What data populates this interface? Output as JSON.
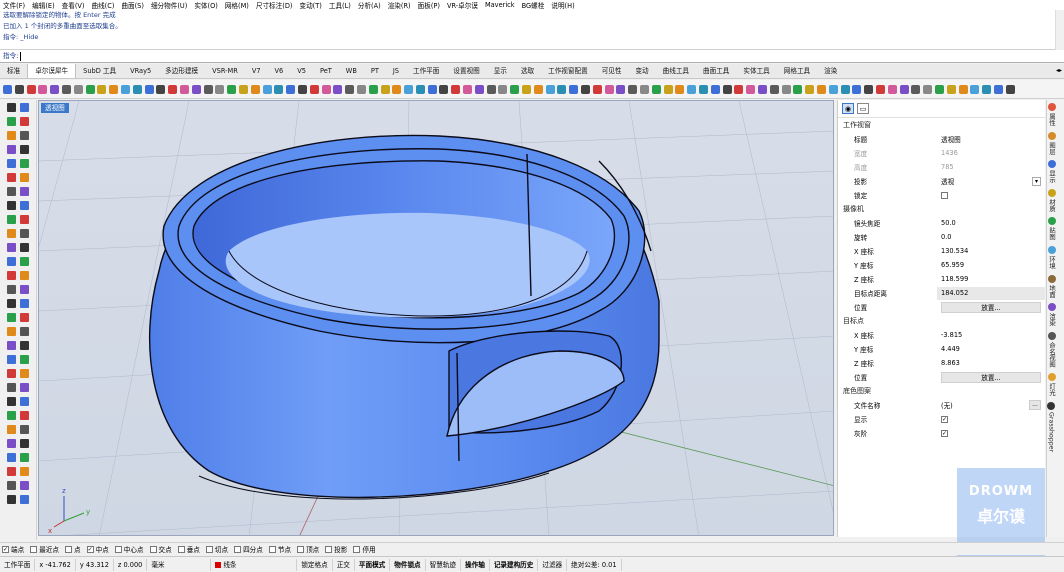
{
  "menu": [
    "文件(F)",
    "编辑(E)",
    "查看(V)",
    "曲线(C)",
    "曲面(S)",
    "细分物件(U)",
    "实体(O)",
    "网格(M)",
    "尺寸标注(D)",
    "变动(T)",
    "工具(L)",
    "分析(A)",
    "渲染(R)",
    "面板(P)",
    "VR-卓尔谟",
    "Maverick",
    "BG螺栓",
    "说明(H)"
  ],
  "history": [
    "选取要解除锁定的物体。按 Enter 完成",
    "已加入 1 个封闭的多重曲面至选取集合。",
    "指令: _Hide"
  ],
  "command_prompt": "指令:",
  "tabs": [
    "标准",
    "卓尔谟犀牛",
    "SubD 工具",
    "VRay5",
    "多边形建模",
    "VSR-MR",
    "V7",
    "V6",
    "V5",
    "PeT",
    "WB",
    "PT",
    "JS",
    "工作平面",
    "设置视图",
    "显示",
    "选取",
    "工作视窗配置",
    "可见性",
    "变动",
    "曲线工具",
    "曲面工具",
    "实体工具",
    "网格工具",
    "渲染"
  ],
  "active_tab_index": 1,
  "viewport": {
    "label": "透视图",
    "axes": {
      "x": "x",
      "y": "y",
      "z": "z"
    }
  },
  "panel": {
    "viewport_section": "工作视窗",
    "viewport_rows": [
      {
        "k": "标题",
        "v": "透视图"
      },
      {
        "k": "宽度",
        "v": "1436"
      },
      {
        "k": "高度",
        "v": "785"
      },
      {
        "k": "投影",
        "v": "透视"
      },
      {
        "k": "锁定",
        "v": ""
      }
    ],
    "camera_section": "摄像机",
    "camera_rows": [
      {
        "k": "镜头焦距",
        "v": "50.0"
      },
      {
        "k": "旋转",
        "v": "0.0"
      },
      {
        "k": "X 座标",
        "v": "130.534"
      },
      {
        "k": "Y 座标",
        "v": "65.959"
      },
      {
        "k": "Z 座标",
        "v": "118.599"
      },
      {
        "k": "目标点距离",
        "v": "184.052"
      },
      {
        "k": "位置",
        "v": "放置..."
      }
    ],
    "target_section": "目标点",
    "target_rows": [
      {
        "k": "X 座标",
        "v": "-3.815"
      },
      {
        "k": "Y 座标",
        "v": "4.449"
      },
      {
        "k": "Z 座标",
        "v": "8.863"
      },
      {
        "k": "位置",
        "v": "放置..."
      }
    ],
    "bg_section": "底色图案",
    "bg_rows": [
      {
        "k": "文件名称",
        "v": "(无)"
      },
      {
        "k": "显示",
        "v": ""
      },
      {
        "k": "灰阶",
        "v": ""
      }
    ],
    "ellipsis": "..."
  },
  "vtabs": [
    "属性",
    "图层",
    "显示",
    "材质",
    "贴图",
    "环境",
    "地面",
    "渲染",
    "命名视图",
    "灯光",
    "Grasshopper"
  ],
  "watermark": {
    "line1": "DROWM",
    "line2": "卓尔谟"
  },
  "osnap": [
    {
      "label": "端点",
      "checked": true
    },
    {
      "label": "最近点",
      "checked": false
    },
    {
      "label": "点",
      "checked": false
    },
    {
      "label": "中点",
      "checked": true
    },
    {
      "label": "中心点",
      "checked": false
    },
    {
      "label": "交点",
      "checked": false
    },
    {
      "label": "垂点",
      "checked": false
    },
    {
      "label": "切点",
      "checked": false
    },
    {
      "label": "四分点",
      "checked": false
    },
    {
      "label": "节点",
      "checked": false
    },
    {
      "label": "顶点",
      "checked": false
    },
    {
      "label": "投影",
      "checked": false
    },
    {
      "label": "停用",
      "checked": false
    }
  ],
  "status": {
    "plane": "工作平面",
    "x": "x -41.762",
    "y": "y 43.312",
    "z": "z 0.000",
    "unit": "毫米",
    "layer": "线条",
    "items": [
      "锁定格点",
      "正交",
      "平面模式",
      "物件锁点",
      "智慧轨迹",
      "操作轴",
      "记录建构历史",
      "过滤器",
      "绝对公差: 0.01"
    ]
  },
  "colors": {
    "accent": "#3b78c7",
    "ring": "#5d8ff0",
    "viewport_bg": "#d3dae6"
  }
}
